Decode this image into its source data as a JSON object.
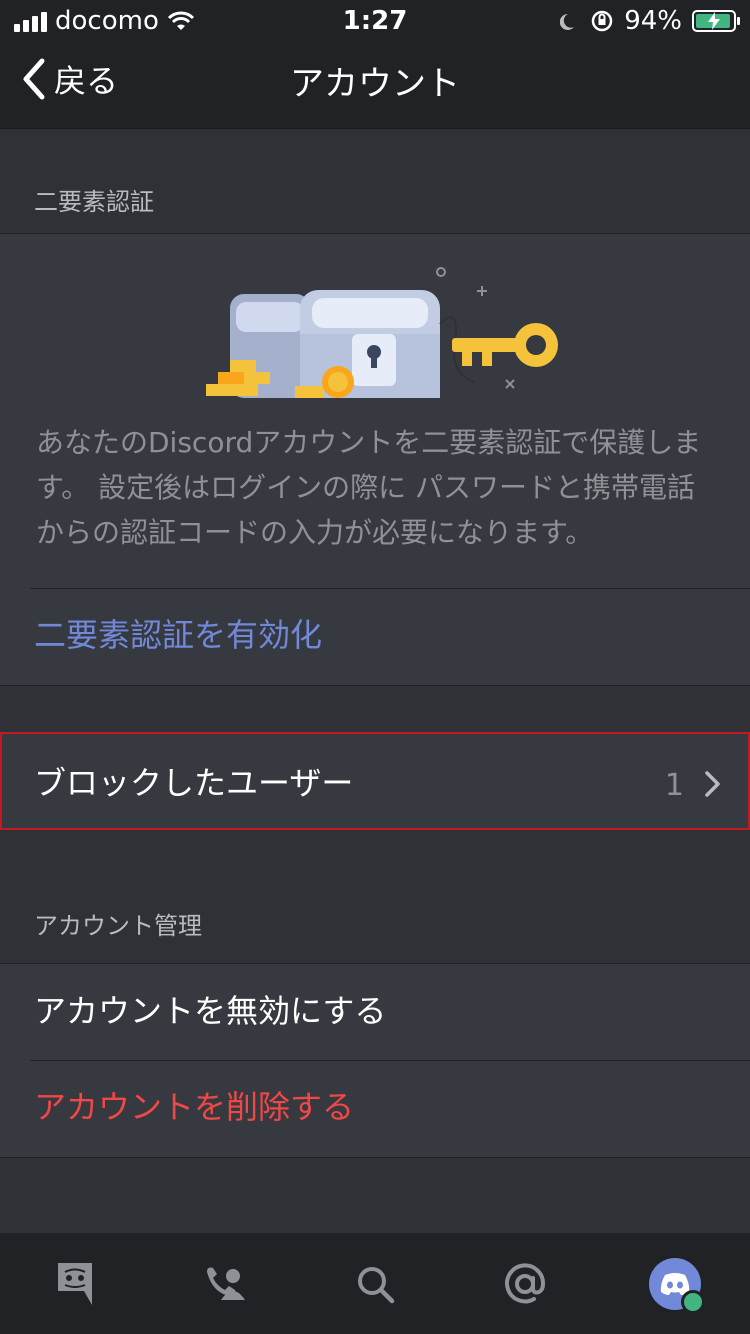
{
  "status_bar": {
    "carrier": "docomo",
    "time": "1:27",
    "battery": "94%"
  },
  "nav": {
    "back_label": "戻る",
    "title": "アカウント"
  },
  "two_factor": {
    "header": "二要素認証",
    "description": "あなたのDiscordアカウントを二要素認証で保護します。 設定後はログインの際に パスワードと携帯電話からの認証コードの入力が必要になります。",
    "enable_label": "二要素認証を有効化"
  },
  "blocked_users": {
    "label": "ブロックしたユーザー",
    "count": "1"
  },
  "account_management": {
    "header": "アカウント管理",
    "disable_label": "アカウントを無効にする",
    "delete_label": "アカウントを削除する"
  },
  "colors": {
    "link": "#7289da",
    "danger": "#f04747",
    "highlight_border": "#c21a22",
    "online": "#43b581"
  },
  "tabbar": {
    "icons": [
      "discord-home-icon",
      "friends-icon",
      "search-icon",
      "mentions-icon",
      "profile-avatar"
    ]
  }
}
